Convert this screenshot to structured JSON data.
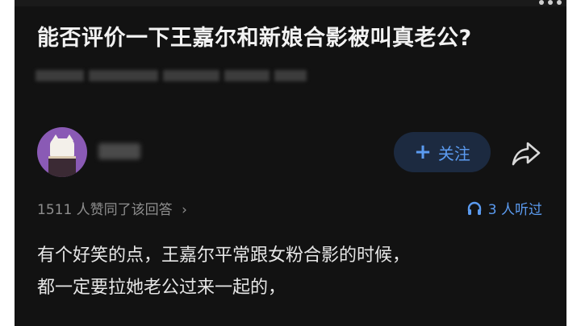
{
  "question": {
    "title": "能否评价一下王嘉尔和新娘合影被叫真老公?"
  },
  "author": {
    "avatar_icon": "cat-avatar-icon",
    "follow_label": "关注",
    "follow_icon": "plus-icon",
    "share_icon": "share-arrow-icon"
  },
  "stats": {
    "agree_text": "1511 人赞同了该回答",
    "agree_chevron": "›",
    "listen_text": "3 人听过",
    "listen_icon": "headphones-icon"
  },
  "answer": {
    "lines": [
      "有个好笑的点，王嘉尔平常跟女粉合影的时候，",
      "都一定要拉她老公过来一起的，"
    ]
  },
  "colors": {
    "background": "#121212",
    "accent": "#5b9bf0",
    "avatar": "#8a5ab5"
  }
}
